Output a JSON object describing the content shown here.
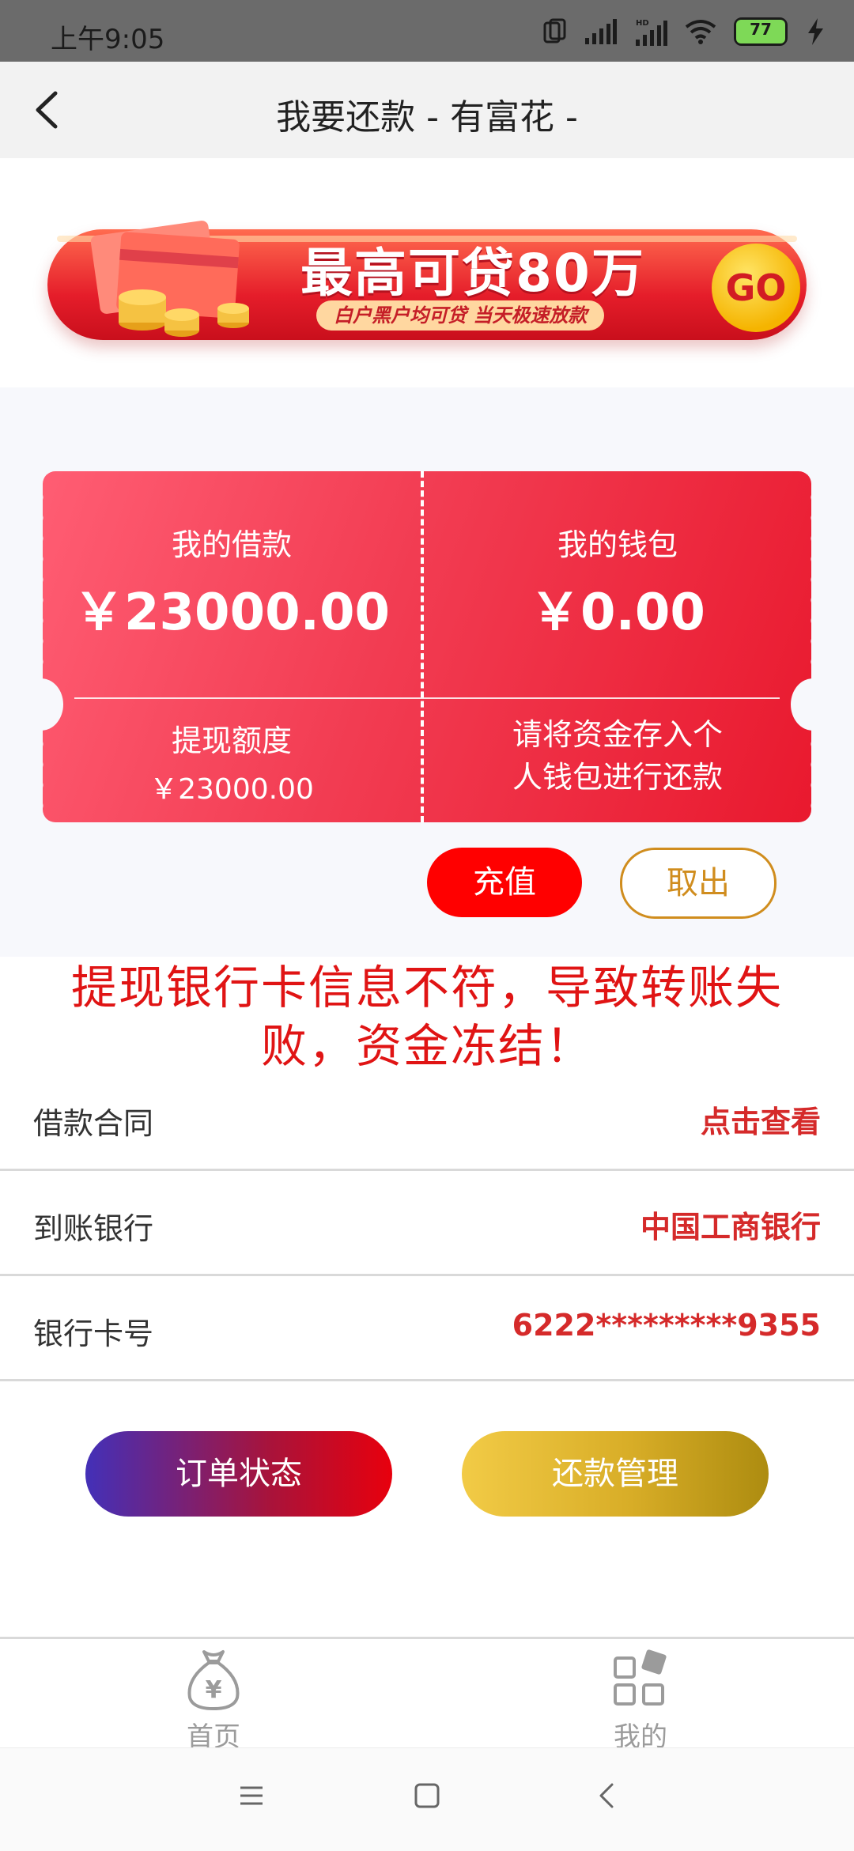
{
  "status_bar": {
    "time": "上午9:05",
    "battery": "77",
    "icons": [
      "sim-icon",
      "signal-icon",
      "hd-signal-icon",
      "wifi-icon",
      "battery-icon",
      "charging-icon"
    ]
  },
  "header": {
    "title": "我要还款 - 有富花 -",
    "back_icon": "chevron-left-icon"
  },
  "banner": {
    "headline": "最高可贷80万",
    "subtitle": "白户黑户均可贷 当天极速放款",
    "go": "GO",
    "colors": {
      "primary": "#e51d2a",
      "accent": "#f5b400"
    }
  },
  "wallet_card": {
    "loan_label": "我的借款",
    "loan_amount": "￥23000.00",
    "wallet_label": "我的钱包",
    "wallet_amount": "￥0.00",
    "withdraw_limit_label": "提现额度",
    "withdraw_limit_amount": "￥23000.00",
    "notice_line1": "请将资金存入个",
    "notice_line2": "人钱包进行还款"
  },
  "actions": {
    "recharge": "充值",
    "withdraw": "取出"
  },
  "warning": {
    "text": "提现银行卡信息不符，导致转账失败，资金冻结！",
    "color": "#e01414"
  },
  "info_rows": [
    {
      "label": "借款合同",
      "value": "点击查看"
    },
    {
      "label": "到账银行",
      "value": "中国工商银行"
    },
    {
      "label": "银行卡号",
      "value": "6222*********9355"
    }
  ],
  "bottom_buttons": {
    "order_status": "订单状态",
    "repay_manage": "还款管理"
  },
  "tabs": [
    {
      "label": "首页",
      "icon": "money-bag-icon"
    },
    {
      "label": "我的",
      "icon": "grid-apps-icon"
    }
  ],
  "system_nav": [
    "menu-icon",
    "home-square-icon",
    "back-triangle-icon"
  ]
}
